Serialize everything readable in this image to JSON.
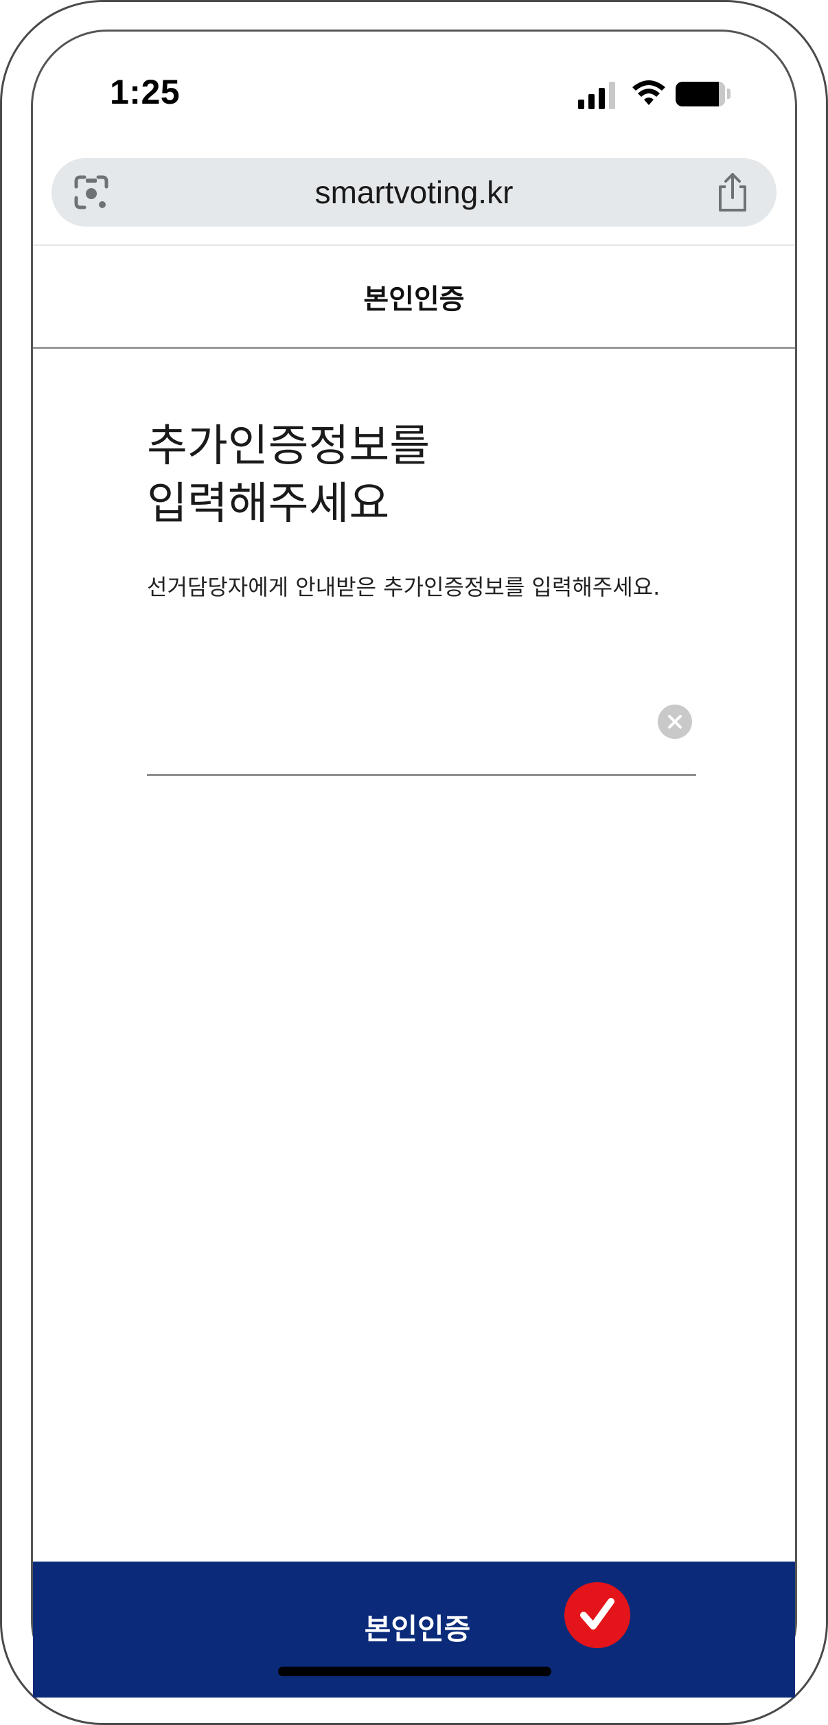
{
  "status_bar": {
    "time": "1:25"
  },
  "browser": {
    "url": "smartvoting.kr"
  },
  "header": {
    "title": "본인인증"
  },
  "main": {
    "title_line1": "추가인증정보를",
    "title_line2": "입력해주세요",
    "description": "선거담당자에게 안내받은 추가인증정보를 입력해주세요.",
    "input": {
      "value": "",
      "placeholder": ""
    }
  },
  "footer": {
    "submit_label": "본인인증"
  },
  "colors": {
    "brand_navy": "#0b2b7a",
    "badge_red": "#e3141a"
  },
  "icons": [
    "google-lens-icon",
    "share-icon",
    "clear-icon",
    "check-icon",
    "signal-icon",
    "wifi-icon",
    "battery-icon"
  ]
}
